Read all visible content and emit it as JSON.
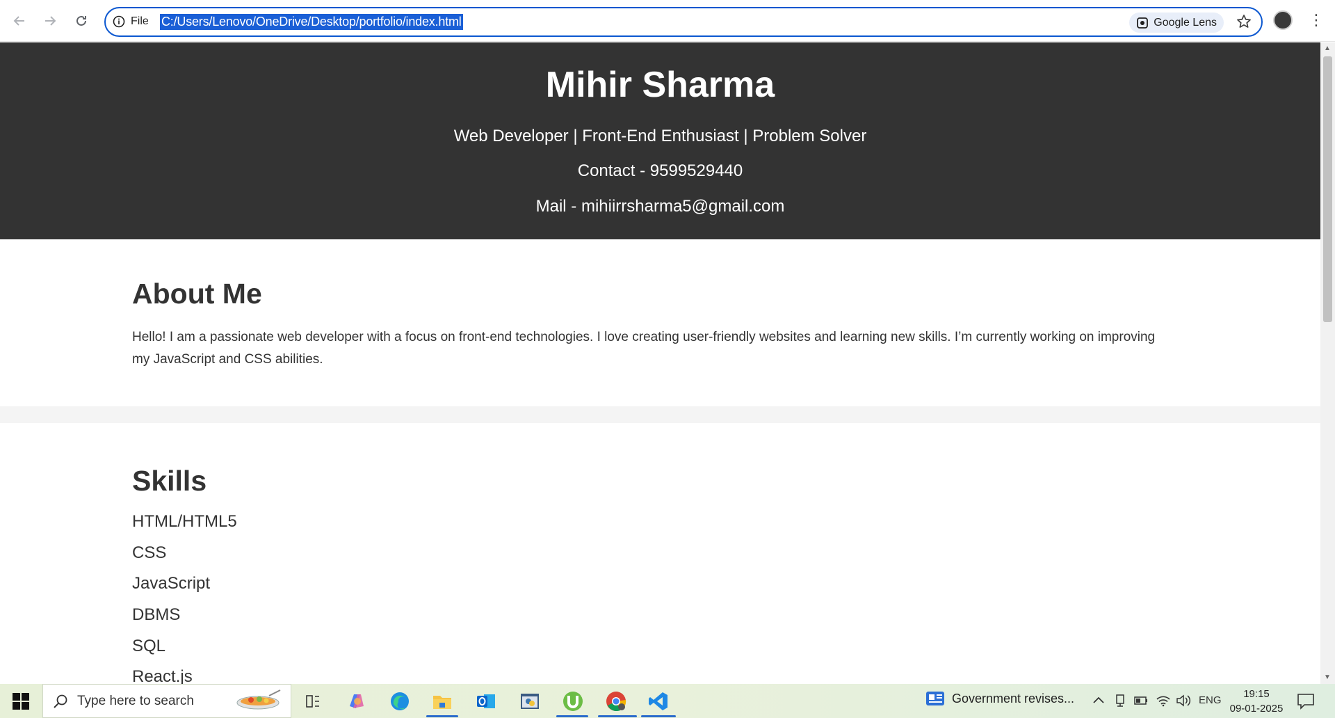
{
  "browser": {
    "site_info_label": "File",
    "url": "C:/Users/Lenovo/OneDrive/Desktop/portfolio/index.html",
    "lens_label": "Google Lens"
  },
  "page": {
    "name": "Mihir Sharma",
    "tagline": "Web Developer | Front-End Enthusiast | Problem Solver",
    "contact": "Contact - 9599529440",
    "mail": "Mail - mihiirrsharma5@gmail.com",
    "about": {
      "heading": "About Me",
      "text": "Hello! I am a passionate web developer with a focus on front-end technologies. I love creating user-friendly websites and learning new skills. I’m currently working on improving my JavaScript and CSS abilities."
    },
    "skills": {
      "heading": "Skills",
      "items": [
        "HTML/HTML5",
        "CSS",
        "JavaScript",
        "DBMS",
        "SQL",
        "React.js"
      ]
    }
  },
  "taskbar": {
    "search_placeholder": "Type here to search",
    "news": "Government revises...",
    "language": "ENG",
    "time": "19:15",
    "date": "09-01-2025"
  },
  "icons": [
    "back-icon",
    "forward-icon",
    "reload-icon",
    "info-icon",
    "lens-icon",
    "star-icon",
    "profile-avatar",
    "menu-icon",
    "windows-start-icon",
    "search-icon",
    "task-view-icon",
    "copilot-icon",
    "edge-icon",
    "file-explorer-icon",
    "outlook-icon",
    "python-idle-icon",
    "utorrent-icon",
    "chrome-icon",
    "vscode-icon",
    "news-icon",
    "chevron-up-icon",
    "network-icon",
    "battery-icon",
    "wifi-icon",
    "volume-icon",
    "notification-icon"
  ]
}
